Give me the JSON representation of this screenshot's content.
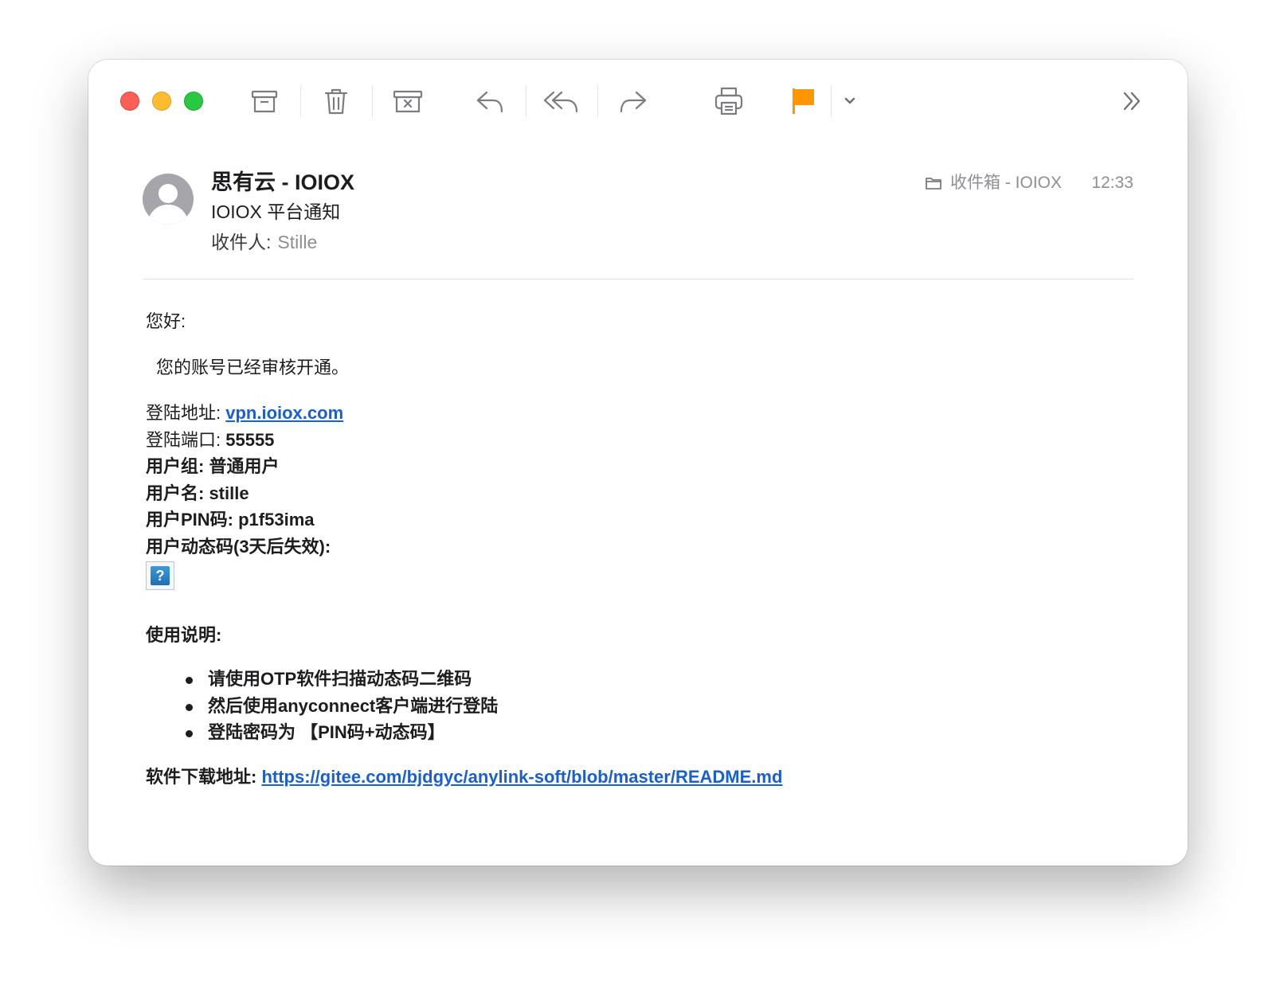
{
  "toolbar": {
    "buttons": [
      {
        "name": "archive-button",
        "icon": "archive-icon"
      },
      {
        "name": "delete-button",
        "icon": "trash-icon"
      },
      {
        "name": "junk-button",
        "icon": "junk-icon"
      },
      {
        "name": "reply-button",
        "icon": "reply-icon"
      },
      {
        "name": "reply-all-button",
        "icon": "reply-all-icon"
      },
      {
        "name": "forward-button",
        "icon": "forward-icon"
      },
      {
        "name": "print-button",
        "icon": "printer-icon"
      },
      {
        "name": "flag-button",
        "icon": "flag-icon"
      },
      {
        "name": "flag-menu-button",
        "icon": "chevron-down-icon"
      },
      {
        "name": "more-button",
        "icon": "double-chevron-right-icon"
      }
    ],
    "flag_color": "#ff9500"
  },
  "header": {
    "sender": "思有云 - IOIOX",
    "subject": "IOIOX 平台通知",
    "recipient_label": "收件人:",
    "recipient": "Stille",
    "mailbox": "收件箱 - IOIOX",
    "time": "12:33"
  },
  "body": {
    "greeting": "您好:",
    "intro": "您的账号已经审核开通。",
    "login_address_label": "登陆地址: ",
    "login_address": "vpn.ioiox.com",
    "login_port_label": "登陆端口: ",
    "login_port": "55555",
    "user_group": "用户组: 普通用户",
    "username": "用户名: stille",
    "user_pin": "用户PIN码: p1f53ima",
    "otp_label": "用户动态码(3天后失效):",
    "broken_image_glyph": "?",
    "usage_title": "使用说明:",
    "steps": [
      "请使用OTP软件扫描动态码二维码",
      "然后使用anyconnect客户端进行登陆",
      "登陆密码为 【PIN码+动态码】"
    ],
    "download_label": "软件下载地址: ",
    "download_url": "https://gitee.com/bjdgyc/anylink-soft/blob/master/README.md"
  },
  "colors": {
    "link": "#1a5fd0",
    "close": "#ff5f57",
    "minimize": "#febc2e",
    "maximize": "#28c840"
  }
}
